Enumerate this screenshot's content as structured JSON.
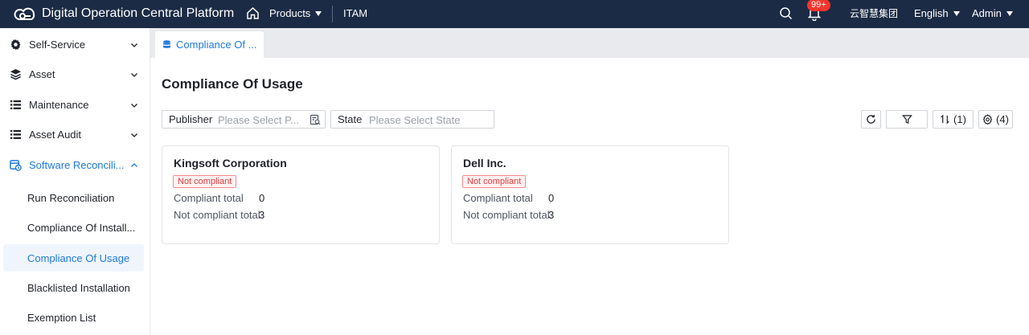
{
  "header": {
    "app_title": "Digital Operation Central Platform",
    "products_label": "Products",
    "module_label": "ITAM",
    "notification_count": "99+",
    "organization": "云智慧集团",
    "language": "English",
    "user": "Admin",
    "background_color": "#1c2b45"
  },
  "sidebar": {
    "menus": [
      {
        "label": "Self-Service",
        "icon": "gear-icon"
      },
      {
        "label": "Asset",
        "icon": "layers-icon"
      },
      {
        "label": "Maintenance",
        "icon": "list-icon"
      },
      {
        "label": "Asset Audit",
        "icon": "list-icon"
      },
      {
        "label": "Software Reconcili...",
        "icon": "software-reconcile-icon"
      }
    ],
    "sub_items": [
      {
        "label": "Run Reconciliation"
      },
      {
        "label": "Compliance Of Install..."
      },
      {
        "label": "Compliance Of Usage"
      },
      {
        "label": "Blacklisted Installation"
      },
      {
        "label": "Exemption List"
      }
    ]
  },
  "tabs": [
    {
      "label": "Compliance Of ..."
    }
  ],
  "page": {
    "title": "Compliance Of Usage"
  },
  "filters": {
    "publisher": {
      "label": "Publisher",
      "placeholder": "Please Select P..."
    },
    "state": {
      "label": "State",
      "placeholder": "Please Select State"
    }
  },
  "toolbar": {
    "sort_count": "(1)",
    "columns_count": "(4)"
  },
  "cards": [
    {
      "title": "Kingsoft Corporation",
      "status": "Not compliant",
      "rows": [
        {
          "label": "Compliant total",
          "value": "0"
        },
        {
          "label": "Not compliant total",
          "value": "3"
        }
      ]
    },
    {
      "title": "Dell Inc.",
      "status": "Not compliant",
      "rows": [
        {
          "label": "Compliant total",
          "value": "0"
        },
        {
          "label": "Not compliant total",
          "value": "3"
        }
      ]
    }
  ],
  "colors": {
    "accent": "#1f7ae0",
    "danger": "#e23b3b",
    "badge": "#f5362e"
  }
}
